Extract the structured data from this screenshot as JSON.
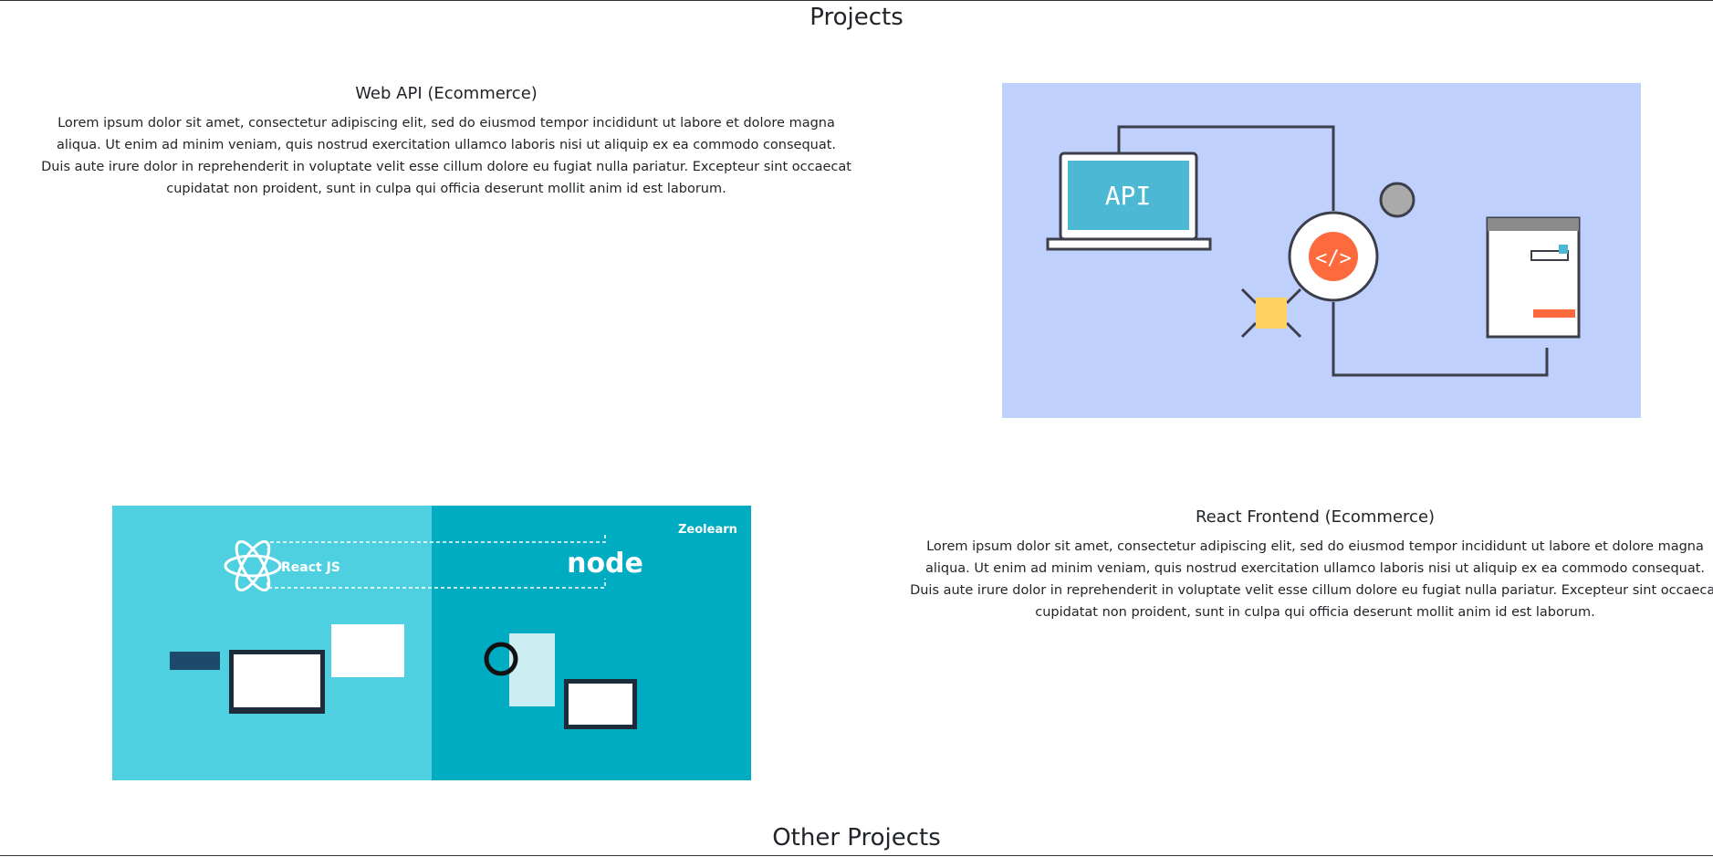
{
  "page": {
    "title": "Projects",
    "other_title": "Other Projects"
  },
  "projects": [
    {
      "title": "Web API (Ecommerce)",
      "description": "Lorem ipsum dolor sit amet, consectetur adipiscing elit, sed do eiusmod tempor incididunt ut labore et dolore magna aliqua. Ut enim ad minim veniam, quis nostrud exercitation ullamco laboris nisi ut aliquip ex ea commodo consequat. Duis aute irure dolor in reprehenderit in voluptate velit esse cillum dolore eu fugiat nulla pariatur. Excepteur sint occaecat cupidatat non proident, sunt in culpa qui officia deserunt mollit anim id est laborum.",
      "image_label": "API",
      "image_bg": "#c0d0fd"
    },
    {
      "title": "React Frontend (Ecommerce)",
      "description": "Lorem ipsum dolor sit amet, consectetur adipiscing elit, sed do eiusmod tempor incididunt ut labore et dolore magna aliqua. Ut enim ad minim veniam, quis nostrud exercitation ullamco laboris nisi ut aliquip ex ea commodo consequat. Duis aute irure dolor in reprehenderit in voluptate velit esse cillum dolore eu fugiat nulla pariatur. Excepteur sint occaecat cupidatat non proident, sunt in culpa qui officia deserunt mollit anim id est laborum.",
      "image_labels": {
        "react": "React JS",
        "node": "node",
        "brand": "Zeolearn"
      },
      "image_bg": [
        "#4fd0e0",
        "#00acc1"
      ]
    }
  ]
}
